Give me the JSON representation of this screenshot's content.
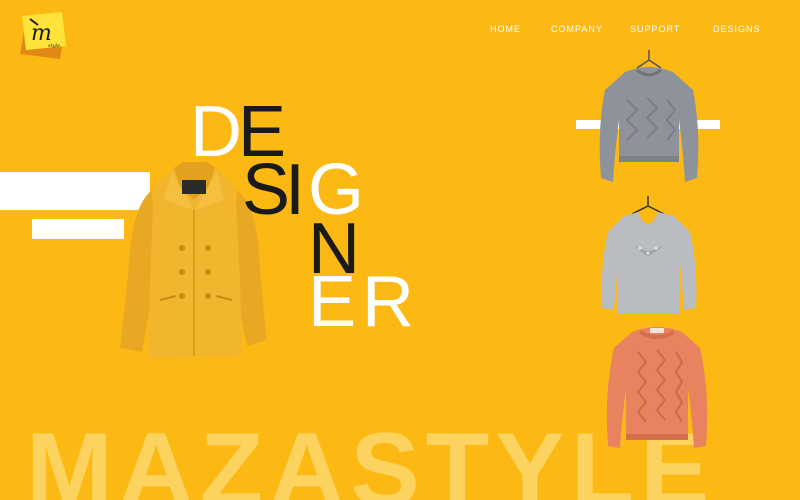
{
  "brand": {
    "logo_text": "m",
    "logo_subtext": "style",
    "watermark": "MAZASTYLE"
  },
  "nav": [
    {
      "label": "HOME"
    },
    {
      "label": "COMPANY"
    },
    {
      "label": "SUPPORT"
    },
    {
      "label": "DESIGNS"
    }
  ],
  "hero": {
    "letters": [
      "D",
      "E",
      "S",
      "I",
      "G",
      "N",
      "E",
      "R"
    ]
  },
  "products": [
    {
      "name": "yellow-coat"
    },
    {
      "name": "grey-cable-sweater"
    },
    {
      "name": "grey-embellished-sweater"
    },
    {
      "name": "coral-knit-sweater"
    }
  ],
  "colors": {
    "background": "#FDB913",
    "accent_white": "#FFFFFF",
    "text_dark": "#1A1A1A",
    "watermark": "#FCD35E",
    "coat": "#F2B52E",
    "sweater_grey": "#8E939B",
    "sweater_light_grey": "#B9BCC1",
    "sweater_coral": "#E8825F"
  }
}
